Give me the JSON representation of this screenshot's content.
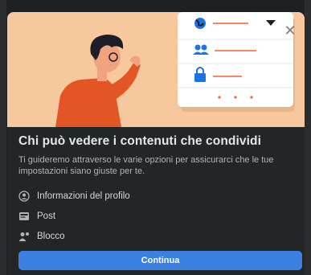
{
  "dialog": {
    "title": "Chi può vedere i contenuti che condividi",
    "description": "Ti guideremo attraverso le varie opzioni per assicurarci che le tue impostazioni siano giuste per te.",
    "close_icon": "close-icon",
    "items": [
      {
        "label": "Informazioni del profilo",
        "icon": "profile-info-icon"
      },
      {
        "label": "Post",
        "icon": "post-icon"
      },
      {
        "label": "Blocco",
        "icon": "block-icon"
      }
    ],
    "primary_button": "Continua"
  },
  "colors": {
    "hero_background": "#f7c79e",
    "primary_button": "#3b82e0",
    "accent_orange": "#f0632c",
    "dialog_background": "#242526"
  }
}
